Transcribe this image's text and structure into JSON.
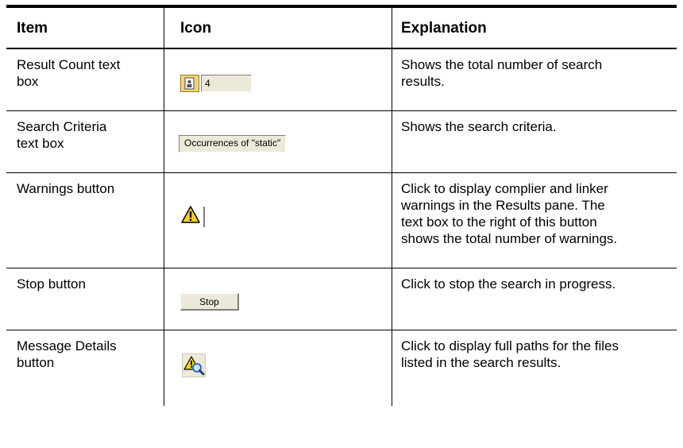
{
  "headers": {
    "item": "Item",
    "icon": "Icon",
    "explanation": "Explanation"
  },
  "rows": [
    {
      "item_lines": [
        "Result Count text",
        "box"
      ],
      "icon_text": "4",
      "icon_name": "result-count-textbox",
      "explanation_lines": [
        "Shows the total number of search",
        "results."
      ]
    },
    {
      "item_lines": [
        "Search Criteria",
        "text box"
      ],
      "icon_text": "Occurrences of \"static\"",
      "icon_name": "search-criteria-textbox",
      "explanation_lines": [
        "Shows the search criteria."
      ]
    },
    {
      "item_lines": [
        "Warnings button"
      ],
      "icon_name": "warning-icon",
      "explanation_lines": [
        "Click to display complier and linker",
        "warnings in the Results pane. The",
        "text box to the right of this button",
        "shows the total number of warnings."
      ]
    },
    {
      "item_lines": [
        "Stop button"
      ],
      "icon_text": "Stop",
      "icon_name": "stop-button",
      "explanation_lines": [
        "Click to stop the search in progress."
      ]
    },
    {
      "item_lines": [
        "Message Details",
        "button"
      ],
      "icon_name": "message-details-icon",
      "explanation_lines": [
        "Click to display full paths for the files",
        "listed in the search results."
      ]
    }
  ],
  "colors": {
    "rule": "#000000",
    "widget_face": "#ece9d8",
    "warning_yellow": "#f6d21e",
    "magnifier_blue": "#2f6fc6"
  }
}
